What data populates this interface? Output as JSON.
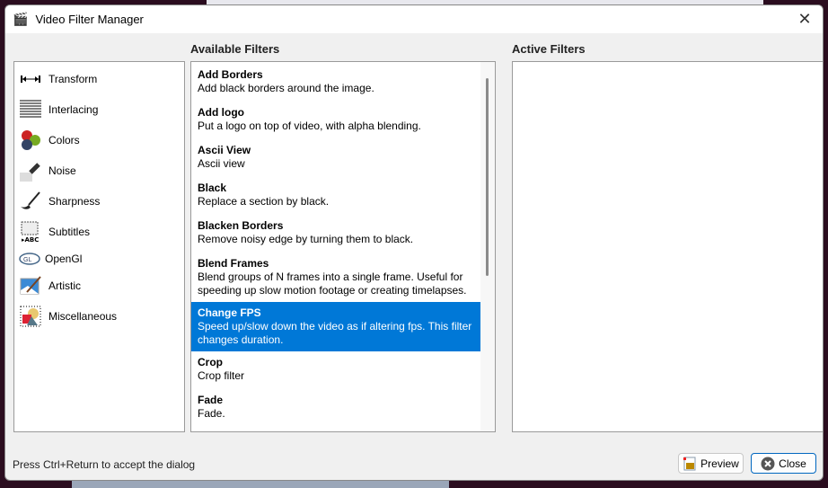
{
  "window": {
    "title": "Video Filter Manager",
    "close_icon": "close-icon"
  },
  "headings": {
    "available": "Available Filters",
    "active": "Active Filters"
  },
  "categories": [
    {
      "label": "Transform",
      "icon": "transform-icon"
    },
    {
      "label": "Interlacing",
      "icon": "interlacing-icon"
    },
    {
      "label": "Colors",
      "icon": "colors-icon"
    },
    {
      "label": "Noise",
      "icon": "noise-icon"
    },
    {
      "label": "Sharpness",
      "icon": "sharpness-icon"
    },
    {
      "label": "Subtitles",
      "icon": "subtitles-icon"
    },
    {
      "label": "OpenGl",
      "icon": "opengl-icon"
    },
    {
      "label": "Artistic",
      "icon": "artistic-icon"
    },
    {
      "label": "Miscellaneous",
      "icon": "miscellaneous-icon"
    }
  ],
  "filters": [
    {
      "name": "Add Borders",
      "desc": "Add black borders around the image."
    },
    {
      "name": "Add logo",
      "desc": "Put a logo on top of video, with alpha blending."
    },
    {
      "name": "Ascii View",
      "desc": "Ascii view"
    },
    {
      "name": "Black",
      "desc": "Replace a section by black."
    },
    {
      "name": "Blacken Borders",
      "desc": "Remove noisy edge by turning them to black."
    },
    {
      "name": "Blend Frames",
      "desc": "Blend groups of N frames into a single frame.  Useful for speeding up slow motion footage or creating timelapses."
    },
    {
      "name": "Change FPS",
      "desc": "Speed up/slow down the video as if altering fps. This filter changes duration.",
      "selected": true
    },
    {
      "name": "Crop",
      "desc": "Crop filter"
    },
    {
      "name": "Fade",
      "desc": "Fade."
    }
  ],
  "footer": {
    "hint": "Press Ctrl+Return to accept the dialog",
    "preview": "Preview",
    "close": "Close"
  },
  "colors": {
    "selection": "#0078d7"
  }
}
